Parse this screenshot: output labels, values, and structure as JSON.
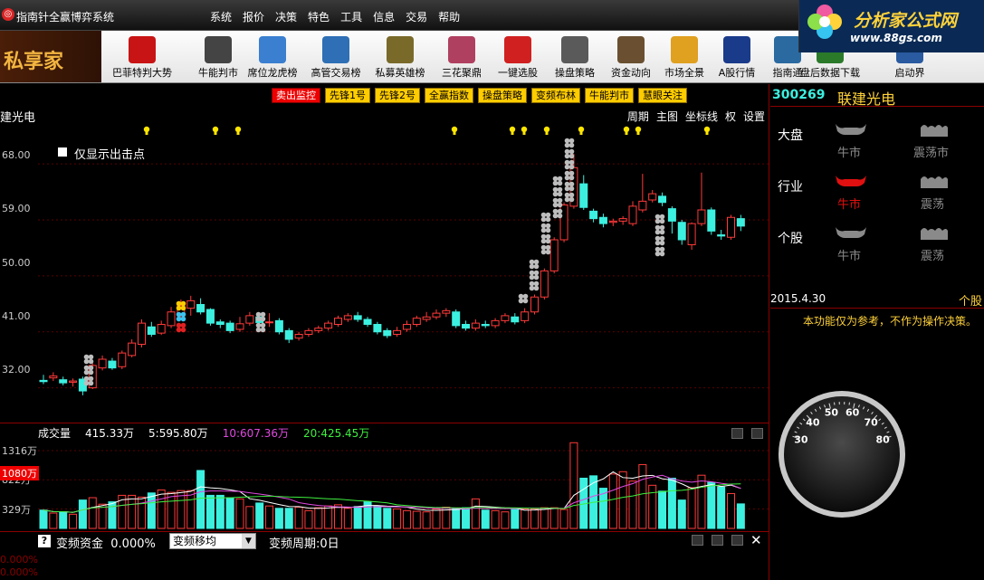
{
  "window": {
    "title": "指南针全赢博弈系统",
    "menu": [
      "系统",
      "报价",
      "决策",
      "特色",
      "工具",
      "信息",
      "交易",
      "帮助"
    ]
  },
  "brand": {
    "name": "分析家公式网",
    "url": "www.88gs.com"
  },
  "toolbar": {
    "private_logo": "私享家",
    "tools": [
      {
        "label": "巴菲特判大势",
        "icon": "buffett-icon",
        "color": "#c81414"
      },
      {
        "label": "牛能判市",
        "icon": "bull-power-icon",
        "color": "#444444"
      },
      {
        "label": "席位龙虎榜",
        "icon": "line-chart-icon",
        "color": "#3a7fd0"
      },
      {
        "label": "高管交易榜",
        "icon": "executive-icon",
        "color": "#2e6fb5"
      },
      {
        "label": "私募英雄榜",
        "icon": "hero-icon",
        "color": "#7a6a2a"
      },
      {
        "label": "三花聚鼎",
        "icon": "three-flowers-icon",
        "color": "#b04060"
      },
      {
        "label": "一键选股",
        "icon": "rising-chart-icon",
        "color": "#d02020"
      },
      {
        "label": "操盘策略",
        "icon": "bar-chart-icon",
        "color": "#5a5a5a"
      },
      {
        "label": "资金动向",
        "icon": "money-bag-icon",
        "color": "#6a5030"
      },
      {
        "label": "市场全景",
        "icon": "pie-chart-icon",
        "color": "#e0a020"
      },
      {
        "label": "A股行情",
        "icon": "a-share-icon",
        "color": "#1a3a8a"
      },
      {
        "label": "指南通",
        "icon": "guide-icon",
        "color": "#2a6aa0"
      },
      {
        "label": "盘后数据下载",
        "icon": "download-icon",
        "color": "#2a7a2a"
      },
      {
        "label": "启动界",
        "icon": "launch-icon",
        "color": "#2a5aa0"
      }
    ]
  },
  "chart": {
    "tabs": [
      "卖出监控",
      "先锋1号",
      "先锋2号",
      "全赢指数",
      "操盘策略",
      "变频布林",
      "牛能判市",
      "慧眼关注"
    ],
    "stock_short": "建光电",
    "menu": [
      "周期",
      "主图",
      "坐标线",
      "权",
      "设置"
    ],
    "toggle_label": "仅显示出击点",
    "y_ticks": [
      "68.00",
      "59.00",
      "50.00",
      "41.00",
      "32.00"
    ]
  },
  "chart_data": {
    "type": "candlestick",
    "ylim": [
      27,
      75
    ],
    "candles": [
      [
        33.2,
        33.0,
        34.1,
        32.6
      ],
      [
        33.6,
        33.9,
        34.5,
        33.1
      ],
      [
        33.3,
        32.8,
        33.8,
        32.4
      ],
      [
        32.9,
        33.1,
        33.5,
        32.2
      ],
      [
        33.4,
        31.5,
        33.8,
        30.8
      ],
      [
        32.0,
        35.6,
        36.0,
        31.8
      ],
      [
        35.2,
        36.6,
        37.2,
        34.8
      ],
      [
        36.3,
        35.2,
        36.8,
        34.9
      ],
      [
        35.4,
        37.6,
        38.0,
        35.0
      ],
      [
        37.2,
        39.2,
        39.8,
        36.9
      ],
      [
        39.0,
        42.4,
        43.0,
        38.5
      ],
      [
        41.8,
        40.6,
        42.6,
        40.2
      ],
      [
        40.8,
        42.2,
        42.8,
        40.5
      ],
      [
        42.0,
        44.2,
        45.0,
        41.6
      ],
      [
        43.8,
        45.2,
        46.2,
        43.2
      ],
      [
        44.8,
        46.0,
        46.8,
        43.6
      ],
      [
        45.4,
        44.2,
        46.4,
        43.8
      ],
      [
        44.6,
        42.4,
        44.8,
        42.0
      ],
      [
        42.6,
        42.2,
        43.0,
        41.6
      ],
      [
        42.4,
        41.2,
        42.8,
        40.8
      ],
      [
        41.4,
        42.3,
        43.4,
        41.0
      ],
      [
        42.4,
        43.6,
        44.2,
        42.0
      ],
      [
        43.4,
        42.5,
        43.8,
        42.0
      ],
      [
        42.6,
        42.6,
        44.0,
        41.8
      ],
      [
        42.8,
        41.0,
        43.2,
        40.6
      ],
      [
        41.2,
        39.8,
        41.6,
        39.2
      ],
      [
        40.0,
        40.6,
        41.0,
        39.6
      ],
      [
        40.6,
        41.2,
        41.6,
        40.2
      ],
      [
        41.2,
        41.6,
        42.0,
        40.8
      ],
      [
        41.6,
        42.4,
        42.8,
        41.2
      ],
      [
        42.2,
        43.2,
        43.6,
        41.8
      ],
      [
        43.0,
        43.6,
        44.0,
        42.6
      ],
      [
        43.6,
        43.0,
        44.2,
        42.6
      ],
      [
        43.0,
        42.2,
        43.4,
        41.8
      ],
      [
        42.2,
        41.0,
        42.6,
        40.6
      ],
      [
        41.2,
        40.4,
        41.6,
        40.0
      ],
      [
        40.6,
        41.2,
        41.8,
        40.2
      ],
      [
        41.4,
        42.2,
        42.8,
        41.0
      ],
      [
        42.2,
        43.2,
        43.6,
        41.8
      ],
      [
        43.0,
        43.4,
        44.2,
        42.6
      ],
      [
        43.4,
        44.0,
        44.6,
        43.0
      ],
      [
        44.0,
        44.4,
        44.8,
        43.4
      ],
      [
        44.2,
        42.0,
        44.6,
        41.6
      ],
      [
        42.2,
        41.6,
        42.8,
        41.2
      ],
      [
        41.6,
        42.4,
        43.0,
        41.2
      ],
      [
        42.2,
        42.0,
        42.8,
        41.6
      ],
      [
        42.0,
        42.8,
        43.2,
        41.6
      ],
      [
        42.8,
        43.6,
        44.0,
        42.4
      ],
      [
        43.4,
        42.6,
        44.0,
        42.2
      ],
      [
        42.8,
        44.2,
        44.8,
        42.4
      ],
      [
        44.2,
        46.6,
        47.0,
        43.8
      ],
      [
        46.6,
        50.8,
        51.2,
        46.2
      ],
      [
        50.8,
        55.8,
        56.2,
        50.4
      ],
      [
        55.8,
        61.4,
        61.8,
        55.4
      ],
      [
        61.2,
        67.4,
        69.6,
        60.8
      ],
      [
        64.8,
        61.0,
        66.2,
        60.6
      ],
      [
        60.4,
        59.2,
        60.8,
        58.6
      ],
      [
        59.4,
        58.4,
        60.0,
        57.8
      ],
      [
        58.6,
        58.8,
        59.2,
        58.0
      ],
      [
        58.8,
        59.2,
        59.6,
        58.2
      ],
      [
        58.4,
        61.2,
        62.0,
        58.0
      ],
      [
        60.6,
        62.0,
        66.4,
        60.2
      ],
      [
        62.2,
        63.2,
        63.8,
        61.8
      ],
      [
        62.8,
        61.8,
        63.4,
        61.2
      ],
      [
        60.8,
        58.8,
        61.2,
        56.8
      ],
      [
        58.6,
        55.8,
        59.0,
        55.0
      ],
      [
        55.0,
        58.4,
        58.6,
        54.2
      ],
      [
        58.4,
        60.6,
        66.6,
        58.0
      ],
      [
        60.6,
        57.2,
        61.0,
        56.6
      ],
      [
        56.6,
        56.4,
        57.4,
        55.8
      ],
      [
        56.2,
        59.4,
        59.8,
        55.8
      ],
      [
        59.2,
        58.0,
        59.8,
        57.2
      ]
    ],
    "bulb_x": [
      162,
      238,
      263,
      502,
      566,
      579,
      604,
      642,
      692,
      705,
      781
    ],
    "clover_columns": [
      {
        "x": 98,
        "y_from": 397,
        "y_to": 430,
        "color": "gray"
      },
      {
        "x": 200,
        "y_from": 338,
        "y_to": 373,
        "color": "mixed"
      },
      {
        "x": 288,
        "y_from": 350,
        "y_to": 368,
        "color": "gray"
      },
      {
        "x": 578,
        "y_from": 330,
        "y_to": 341,
        "color": "gray"
      },
      {
        "x": 590,
        "y_from": 292,
        "y_to": 320,
        "color": "gray"
      },
      {
        "x": 603,
        "y_from": 240,
        "y_to": 280,
        "color": "gray"
      },
      {
        "x": 616,
        "y_from": 200,
        "y_to": 236,
        "color": "gray"
      },
      {
        "x": 629,
        "y_from": 158,
        "y_to": 218,
        "color": "gray"
      },
      {
        "x": 729,
        "y_from": 242,
        "y_to": 278,
        "color": "gray"
      }
    ]
  },
  "volume": {
    "title": "成交量",
    "current": "415.33万",
    "ma5": "5:595.80万",
    "ma10": "10:607.36万",
    "ma20": "20:425.45万",
    "y_ticks": [
      "1316万",
      "822万",
      "329万"
    ],
    "highlight": "1080万",
    "bars": [
      310,
      260,
      280,
      240,
      480,
      520,
      410,
      450,
      560,
      560,
      530,
      600,
      650,
      610,
      640,
      640,
      980,
      560,
      560,
      520,
      500,
      370,
      430,
      380,
      340,
      340,
      360,
      300,
      350,
      380,
      400,
      340,
      370,
      450,
      380,
      340,
      330,
      300,
      290,
      280,
      330,
      360,
      340,
      350,
      500,
      310,
      300,
      280,
      320,
      330,
      330,
      350,
      350,
      320,
      1450,
      850,
      890,
      680,
      920,
      960,
      800,
      1080,
      730,
      630,
      850,
      480,
      690,
      900,
      780,
      700,
      590,
      415
    ]
  },
  "indicator": {
    "title": "变频资金",
    "value": "0.000%",
    "select": "变频移均",
    "period": "变频周期:0日",
    "pct_ticks": [
      "0.000%",
      "0.000%"
    ]
  },
  "right_panel": {
    "code": "300269",
    "name": "联建光电",
    "rows": [
      {
        "label": "大盘",
        "left": "牛市",
        "right": "震荡市",
        "left_active": false
      },
      {
        "label": "行业",
        "left": "牛市",
        "right": "震荡",
        "left_active": true
      },
      {
        "label": "个股",
        "left": "牛市",
        "right": "震荡",
        "left_active": false
      }
    ],
    "date": "2015.4.30",
    "gu": "个股",
    "disclaimer": "本功能仅为参考，不作为操作决策。",
    "gauge_ticks": [
      "30",
      "40",
      "50",
      "60",
      "70",
      "80"
    ],
    "gauge_value": 63
  }
}
